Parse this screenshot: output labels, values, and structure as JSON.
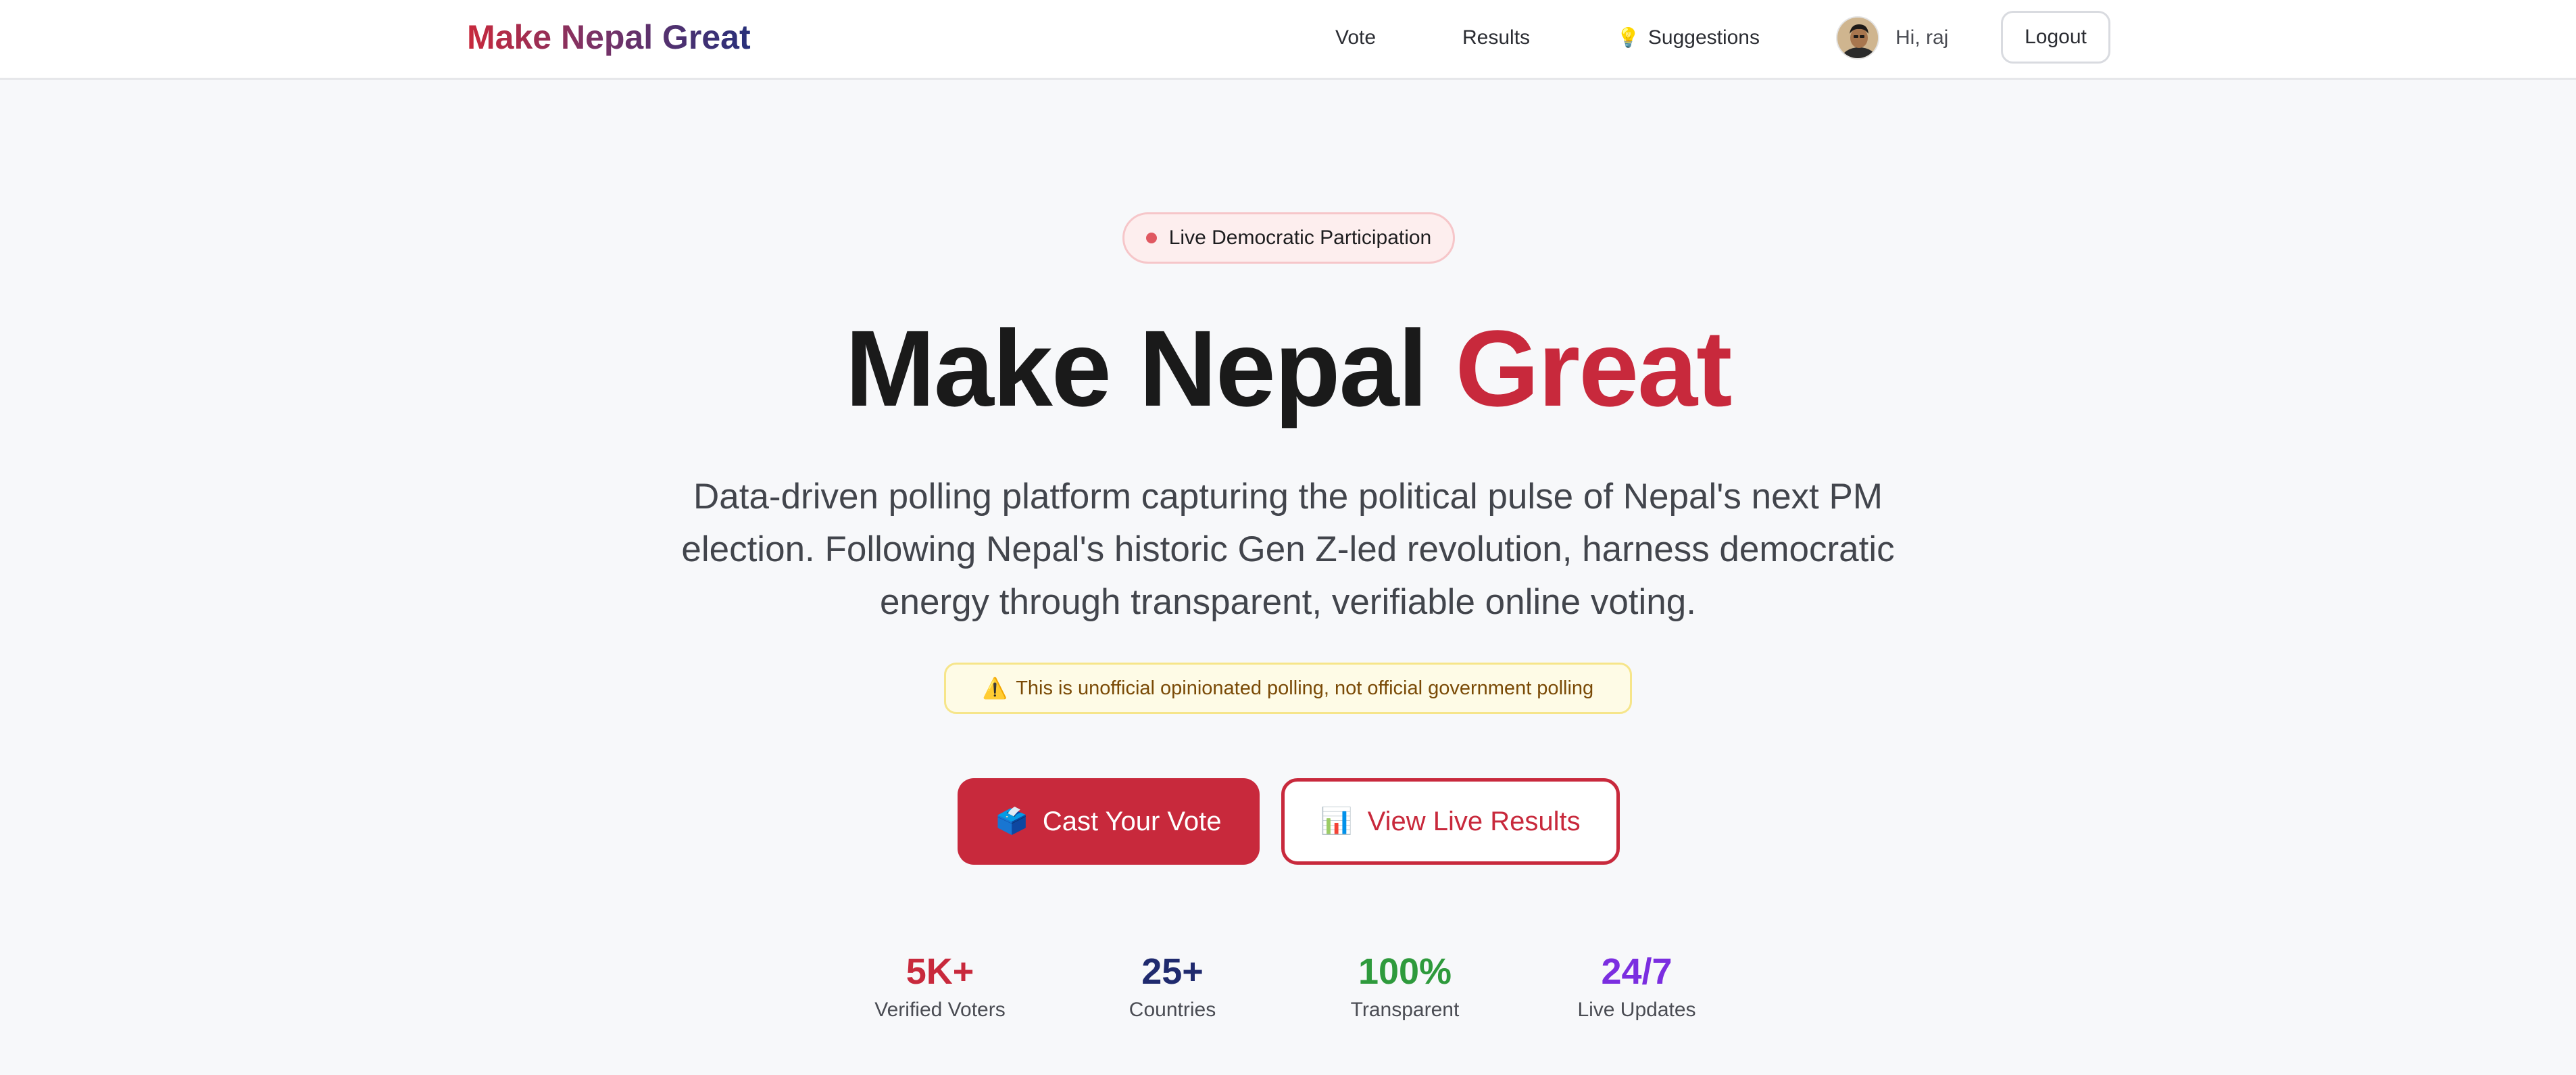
{
  "header": {
    "brand": "Make Nepal Great",
    "nav": {
      "vote": "Vote",
      "results": "Results",
      "suggestions": "Suggestions"
    },
    "user_greeting": "Hi, raj",
    "logout_label": "Logout"
  },
  "hero": {
    "badge_text": "Live Democratic Participation",
    "title_main": "Make Nepal ",
    "title_accent": "Great",
    "description": "Data-driven polling platform capturing the political pulse of Nepal's next PM election. Following Nepal's historic Gen Z-led revolution, harness democratic energy through transparent, verifiable online voting.",
    "disclaimer": "This is unofficial opinionated polling, not official government polling",
    "primary_button": "Cast Your Vote",
    "secondary_button": "View Live Results"
  },
  "stats": [
    {
      "value": "5K+",
      "label": "Verified Voters",
      "color": "#c8293c"
    },
    {
      "value": "25+",
      "label": "Countries",
      "color": "#1f2a6e"
    },
    {
      "value": "100%",
      "label": "Transparent",
      "color": "#2e9a3c"
    },
    {
      "value": "24/7",
      "label": "Live Updates",
      "color": "#7b2ee0"
    }
  ],
  "colors": {
    "brand_red": "#c8293c",
    "brand_navy": "#27307a",
    "warning_bg": "#fefbe6"
  },
  "icons": {
    "suggestions": "lightbulb-icon",
    "disclaimer": "warning-icon",
    "primary_button": "ballot-box-icon",
    "secondary_button": "bar-chart-icon"
  }
}
